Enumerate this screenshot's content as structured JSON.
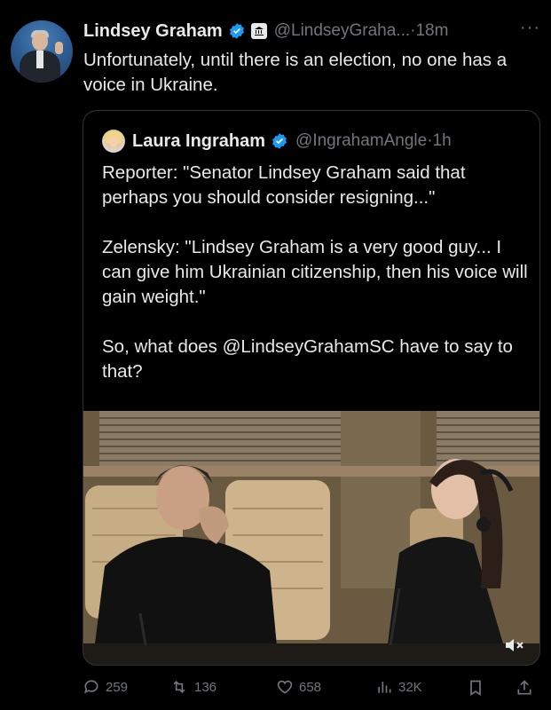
{
  "author": {
    "name": "Lindsey Graham",
    "handle": "@LindseyGraha...",
    "separator": "·",
    "time": "18m",
    "avatar_icon": "profile-photo"
  },
  "tweet": {
    "text": "Unfortunately, until there is an election, no one has a voice in Ukraine."
  },
  "quoted": {
    "name": "Laura Ingraham",
    "handle": "@IngrahamAngle",
    "separator": "·",
    "time": "1h",
    "paragraphs": [
      "Reporter: \"Senator Lindsey Graham said that perhaps you should consider resigning...\"",
      "Zelensky: \"Lindsey Graham is a very good guy... I can give him Ukrainian citizenship, then his voice will gain weight.\"",
      "So, what does @LindseyGrahamSC have to say to that?"
    ],
    "media_icon": "video-muted-icon"
  },
  "actions": {
    "replies": "259",
    "reposts": "136",
    "likes": "658",
    "views": "32K"
  },
  "colors": {
    "background": "#000000",
    "text": "#e7e9ea",
    "muted": "#71767b",
    "verified": "#1d9bf0",
    "border": "#2f3336"
  }
}
